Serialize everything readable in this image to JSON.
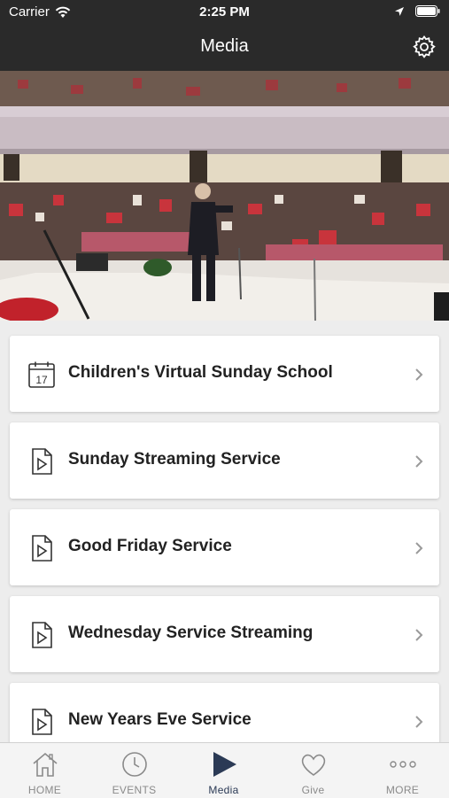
{
  "status_bar": {
    "carrier": "Carrier",
    "time": "2:25 PM"
  },
  "nav": {
    "title": "Media"
  },
  "media_items": [
    {
      "label": "Children's Virtual Sunday School",
      "icon": "calendar-icon",
      "icon_text": "17"
    },
    {
      "label": "Sunday Streaming Service",
      "icon": "video-file-icon"
    },
    {
      "label": "Good Friday Service",
      "icon": "video-file-icon"
    },
    {
      "label": "Wednesday Service Streaming",
      "icon": "video-file-icon"
    },
    {
      "label": "New Years Eve Service",
      "icon": "video-file-icon"
    }
  ],
  "tabs": [
    {
      "label": "HOME",
      "icon": "home-icon",
      "active": false
    },
    {
      "label": "EVENTS",
      "icon": "clock-icon",
      "active": false
    },
    {
      "label": "Media",
      "icon": "play-icon",
      "active": true
    },
    {
      "label": "Give",
      "icon": "heart-icon",
      "active": false
    },
    {
      "label": "MORE",
      "icon": "more-icon",
      "active": false
    }
  ],
  "colors": {
    "header_bg": "#2a2a2a",
    "page_bg": "#ededed",
    "active_tab": "#2b3a55",
    "inactive_tab": "#8a8a8a"
  }
}
